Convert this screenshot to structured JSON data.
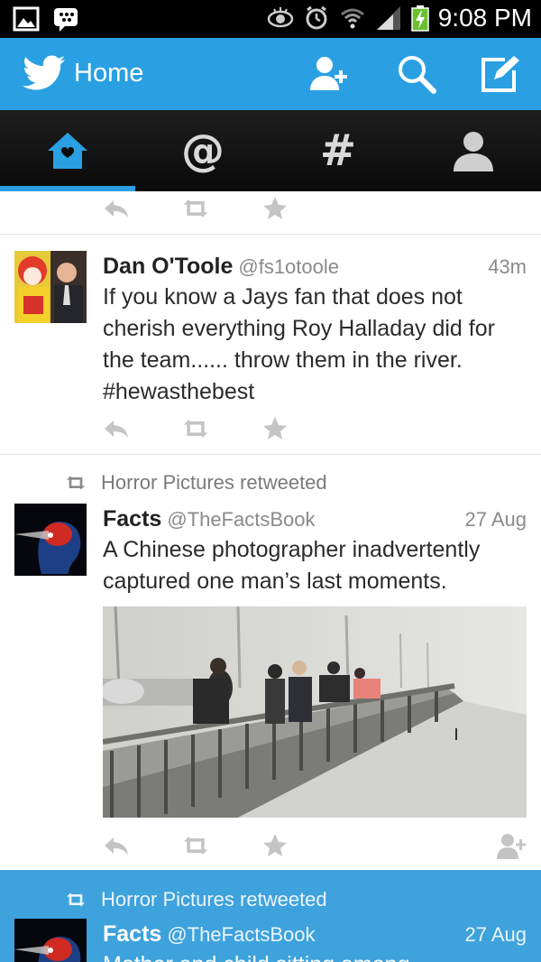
{
  "status_bar": {
    "time": "9:08 PM",
    "icons": [
      "gallery-icon",
      "bbm-icon",
      "eye-icon",
      "alarm-icon",
      "wifi-icon",
      "signal-icon",
      "battery-charging-icon"
    ]
  },
  "app_bar": {
    "title": "Home",
    "accent_color": "#2aa0e3",
    "actions": [
      "add-user-icon",
      "search-icon",
      "compose-icon"
    ]
  },
  "tabs": [
    {
      "name": "home",
      "icon": "home-icon",
      "active": true
    },
    {
      "name": "mentions",
      "icon": "at-icon",
      "glyph": "@"
    },
    {
      "name": "discover",
      "icon": "hashtag-icon",
      "glyph": "#"
    },
    {
      "name": "me",
      "icon": "profile-icon"
    }
  ],
  "tweets": [
    {
      "name": "Dan O'Toole",
      "handle": "@fs1otoole",
      "time": "43m",
      "text": "If you know a Jays fan that does not cherish everything Roy Halladay did for the team...... throw them in the river. #hewasthebest"
    },
    {
      "retweeted_by": "Horror Pictures retweeted",
      "name": "Facts",
      "handle": "@TheFactsBook",
      "time": "27 Aug",
      "text": "A Chinese photographer inadvertently captured one man’s last moments."
    },
    {
      "retweeted_by": "Horror Pictures retweeted",
      "name": "Facts",
      "handle": "@TheFactsBook",
      "time": "27 Aug",
      "text": "Mother and child sitting among"
    }
  ]
}
